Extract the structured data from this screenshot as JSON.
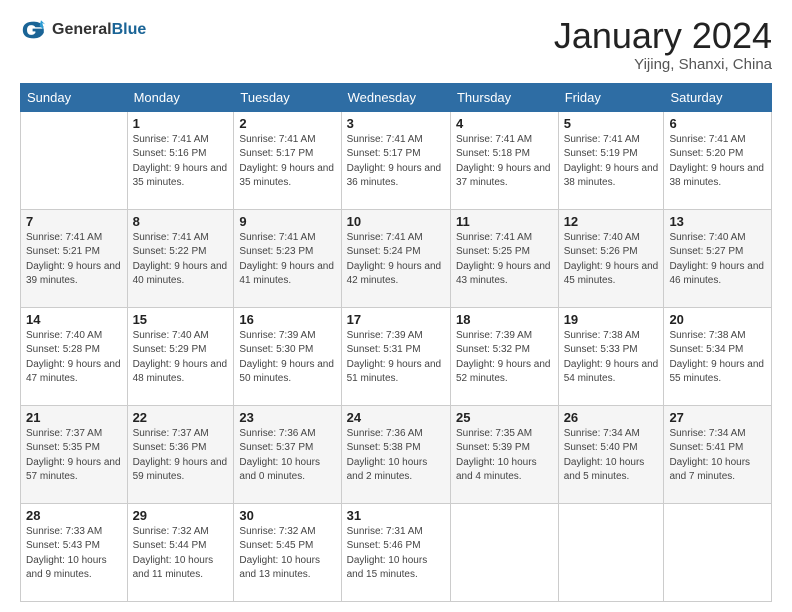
{
  "header": {
    "logo_general": "General",
    "logo_blue": "Blue",
    "month_title": "January 2024",
    "location": "Yijing, Shanxi, China"
  },
  "weekdays": [
    "Sunday",
    "Monday",
    "Tuesday",
    "Wednesday",
    "Thursday",
    "Friday",
    "Saturday"
  ],
  "weeks": [
    [
      {
        "day": "",
        "info": ""
      },
      {
        "day": "1",
        "info": "Sunrise: 7:41 AM\nSunset: 5:16 PM\nDaylight: 9 hours\nand 35 minutes."
      },
      {
        "day": "2",
        "info": "Sunrise: 7:41 AM\nSunset: 5:17 PM\nDaylight: 9 hours\nand 35 minutes."
      },
      {
        "day": "3",
        "info": "Sunrise: 7:41 AM\nSunset: 5:17 PM\nDaylight: 9 hours\nand 36 minutes."
      },
      {
        "day": "4",
        "info": "Sunrise: 7:41 AM\nSunset: 5:18 PM\nDaylight: 9 hours\nand 37 minutes."
      },
      {
        "day": "5",
        "info": "Sunrise: 7:41 AM\nSunset: 5:19 PM\nDaylight: 9 hours\nand 38 minutes."
      },
      {
        "day": "6",
        "info": "Sunrise: 7:41 AM\nSunset: 5:20 PM\nDaylight: 9 hours\nand 38 minutes."
      }
    ],
    [
      {
        "day": "7",
        "info": "Sunrise: 7:41 AM\nSunset: 5:21 PM\nDaylight: 9 hours\nand 39 minutes."
      },
      {
        "day": "8",
        "info": "Sunrise: 7:41 AM\nSunset: 5:22 PM\nDaylight: 9 hours\nand 40 minutes."
      },
      {
        "day": "9",
        "info": "Sunrise: 7:41 AM\nSunset: 5:23 PM\nDaylight: 9 hours\nand 41 minutes."
      },
      {
        "day": "10",
        "info": "Sunrise: 7:41 AM\nSunset: 5:24 PM\nDaylight: 9 hours\nand 42 minutes."
      },
      {
        "day": "11",
        "info": "Sunrise: 7:41 AM\nSunset: 5:25 PM\nDaylight: 9 hours\nand 43 minutes."
      },
      {
        "day": "12",
        "info": "Sunrise: 7:40 AM\nSunset: 5:26 PM\nDaylight: 9 hours\nand 45 minutes."
      },
      {
        "day": "13",
        "info": "Sunrise: 7:40 AM\nSunset: 5:27 PM\nDaylight: 9 hours\nand 46 minutes."
      }
    ],
    [
      {
        "day": "14",
        "info": "Sunrise: 7:40 AM\nSunset: 5:28 PM\nDaylight: 9 hours\nand 47 minutes."
      },
      {
        "day": "15",
        "info": "Sunrise: 7:40 AM\nSunset: 5:29 PM\nDaylight: 9 hours\nand 48 minutes."
      },
      {
        "day": "16",
        "info": "Sunrise: 7:39 AM\nSunset: 5:30 PM\nDaylight: 9 hours\nand 50 minutes."
      },
      {
        "day": "17",
        "info": "Sunrise: 7:39 AM\nSunset: 5:31 PM\nDaylight: 9 hours\nand 51 minutes."
      },
      {
        "day": "18",
        "info": "Sunrise: 7:39 AM\nSunset: 5:32 PM\nDaylight: 9 hours\nand 52 minutes."
      },
      {
        "day": "19",
        "info": "Sunrise: 7:38 AM\nSunset: 5:33 PM\nDaylight: 9 hours\nand 54 minutes."
      },
      {
        "day": "20",
        "info": "Sunrise: 7:38 AM\nSunset: 5:34 PM\nDaylight: 9 hours\nand 55 minutes."
      }
    ],
    [
      {
        "day": "21",
        "info": "Sunrise: 7:37 AM\nSunset: 5:35 PM\nDaylight: 9 hours\nand 57 minutes."
      },
      {
        "day": "22",
        "info": "Sunrise: 7:37 AM\nSunset: 5:36 PM\nDaylight: 9 hours\nand 59 minutes."
      },
      {
        "day": "23",
        "info": "Sunrise: 7:36 AM\nSunset: 5:37 PM\nDaylight: 10 hours\nand 0 minutes."
      },
      {
        "day": "24",
        "info": "Sunrise: 7:36 AM\nSunset: 5:38 PM\nDaylight: 10 hours\nand 2 minutes."
      },
      {
        "day": "25",
        "info": "Sunrise: 7:35 AM\nSunset: 5:39 PM\nDaylight: 10 hours\nand 4 minutes."
      },
      {
        "day": "26",
        "info": "Sunrise: 7:34 AM\nSunset: 5:40 PM\nDaylight: 10 hours\nand 5 minutes."
      },
      {
        "day": "27",
        "info": "Sunrise: 7:34 AM\nSunset: 5:41 PM\nDaylight: 10 hours\nand 7 minutes."
      }
    ],
    [
      {
        "day": "28",
        "info": "Sunrise: 7:33 AM\nSunset: 5:43 PM\nDaylight: 10 hours\nand 9 minutes."
      },
      {
        "day": "29",
        "info": "Sunrise: 7:32 AM\nSunset: 5:44 PM\nDaylight: 10 hours\nand 11 minutes."
      },
      {
        "day": "30",
        "info": "Sunrise: 7:32 AM\nSunset: 5:45 PM\nDaylight: 10 hours\nand 13 minutes."
      },
      {
        "day": "31",
        "info": "Sunrise: 7:31 AM\nSunset: 5:46 PM\nDaylight: 10 hours\nand 15 minutes."
      },
      {
        "day": "",
        "info": ""
      },
      {
        "day": "",
        "info": ""
      },
      {
        "day": "",
        "info": ""
      }
    ]
  ]
}
